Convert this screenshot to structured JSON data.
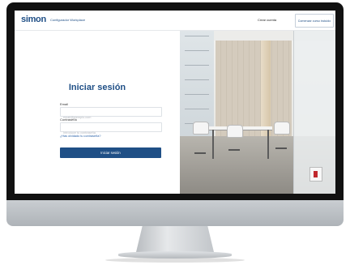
{
  "header": {
    "brand": "simon",
    "brand_subtitle": "Configurador Workplace",
    "contact_link": "Crear cuenta",
    "cta_button": "Comenzar curso incluido"
  },
  "login": {
    "title": "Iniciar sesión",
    "email_label": "Email",
    "email_placeholder": "email@ejemplo.com",
    "password_label": "Contraseña",
    "password_placeholder": "Introduce tu contraseña",
    "forgot_link": "¿Has olvidado tu contraseña?",
    "submit_button": "Iniciar sesión"
  },
  "colors": {
    "brand_blue": "#1f4f86",
    "link_blue": "#2a62a8",
    "socket_red": "#c0282d"
  }
}
